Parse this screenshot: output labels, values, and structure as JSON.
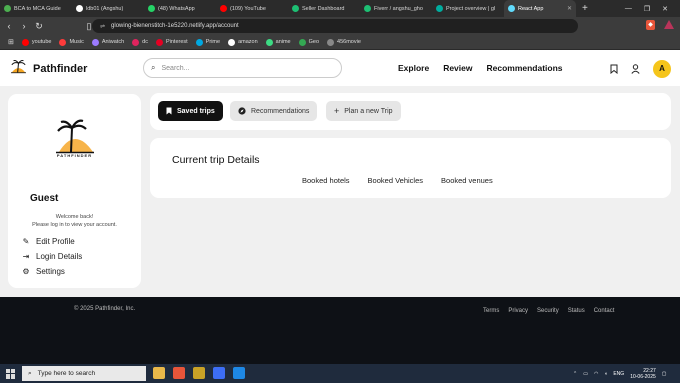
{
  "browser": {
    "tabs": [
      {
        "label": "BCA to MCA Guide",
        "color": "#4caf50"
      },
      {
        "label": "ldb01 (Angshu)",
        "color": "#ffffff"
      },
      {
        "label": "(48) WhatsApp",
        "color": "#25d366"
      },
      {
        "label": "(109) YouTube",
        "color": "#ff0000"
      },
      {
        "label": "Seller Dashboard",
        "color": "#1dbf73"
      },
      {
        "label": "Fiverr / angshu_gho",
        "color": "#1dbf73"
      },
      {
        "label": "Project overview | gl",
        "color": "#00ad9f"
      },
      {
        "label": "React App",
        "color": "#61dafb",
        "active": true
      }
    ],
    "url": "glowing-bienenstitch-1e5220.netlify.app/account",
    "bookmarks": [
      {
        "label": "youtube",
        "color": "#ff0000"
      },
      {
        "label": "Music",
        "color": "#ff3b3b"
      },
      {
        "label": "Aniwatch",
        "color": "#9c7bff"
      },
      {
        "label": "dc",
        "color": "#e0245e"
      },
      {
        "label": "Pinterest",
        "color": "#e60023"
      },
      {
        "label": "Prime",
        "color": "#00a8e1"
      },
      {
        "label": "amazon",
        "color": "#ffffff"
      },
      {
        "label": "anime",
        "color": "#3ddc84"
      },
      {
        "label": "Geo",
        "color": "#34a853"
      },
      {
        "label": "456movie",
        "color": "#888888"
      }
    ]
  },
  "app": {
    "brand": "Pathfinder",
    "search_placeholder": "Search...",
    "nav": [
      "Explore",
      "Review",
      "Recommendations"
    ],
    "avatar_initial": "A"
  },
  "sidebar": {
    "logo_caption": "PATHFINDER",
    "name": "Guest",
    "welcome_line1": "Welcome back!",
    "welcome_line2": "Please log in to view your account.",
    "links": [
      "Edit Profile",
      "Login Details",
      "Settings"
    ]
  },
  "buttons": {
    "saved": "Saved trips",
    "recommendations": "Recommendations",
    "plan": "Plan a new Trip"
  },
  "details": {
    "title": "Current trip Details",
    "tabs": [
      "Booked hotels",
      "Booked Vehicles",
      "Booked venues"
    ]
  },
  "footer": {
    "copyright": "© 2025 Pathfinder, Inc.",
    "links": [
      "Terms",
      "Privacy",
      "Security",
      "Status",
      "Contact"
    ]
  },
  "taskbar": {
    "search_placeholder": "Type here to search",
    "lang": "ENG",
    "time": "22:27",
    "date": "10-06-2025"
  }
}
